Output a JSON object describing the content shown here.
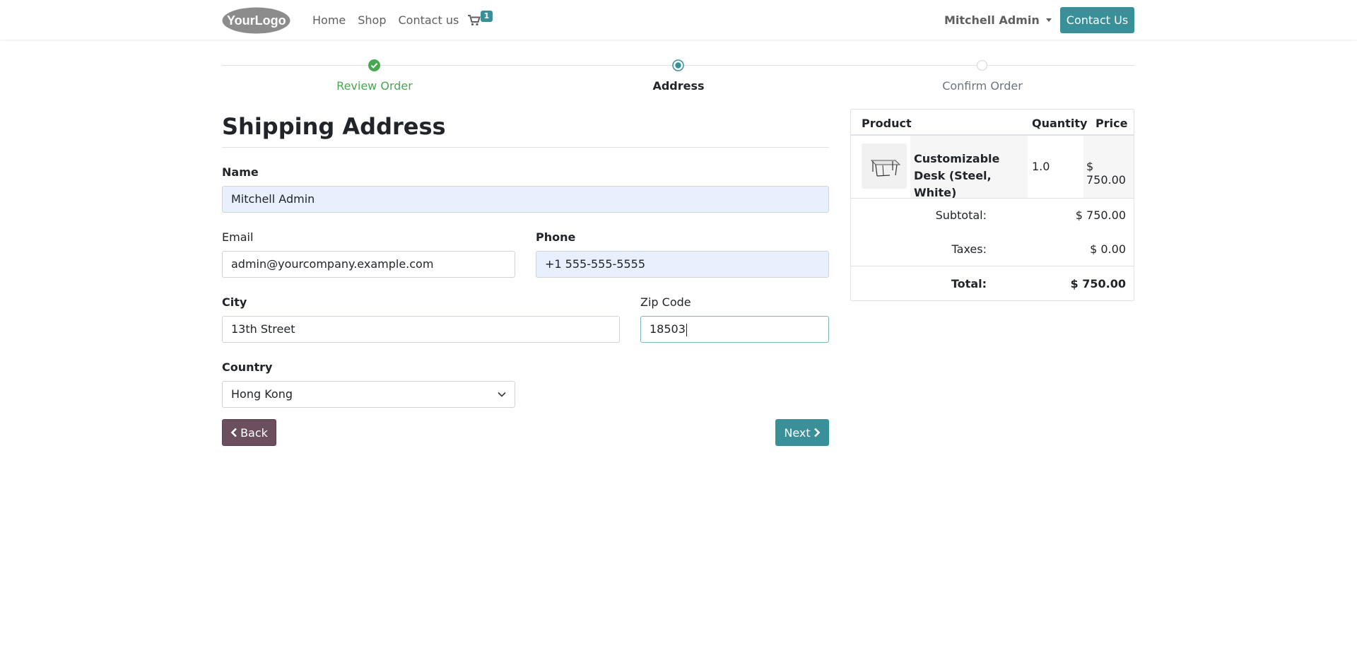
{
  "header": {
    "logo_text": "YourLogo",
    "nav": [
      {
        "label": "Home"
      },
      {
        "label": "Shop"
      },
      {
        "label": "Contact us"
      }
    ],
    "cart_count": "1",
    "user_name": "Mitchell Admin",
    "contact_button": "Contact Us"
  },
  "progress": {
    "steps": [
      {
        "label": "Review Order",
        "state": "done"
      },
      {
        "label": "Address",
        "state": "active"
      },
      {
        "label": "Confirm Order",
        "state": "pending"
      }
    ]
  },
  "form": {
    "title": "Shipping Address",
    "name_label": "Name",
    "name_value": "Mitchell Admin",
    "email_label": "Email",
    "email_value": "admin@yourcompany.example.com",
    "phone_label": "Phone",
    "phone_value": "+1 555-555-5555",
    "city_label": "City",
    "city_value": "13th Street",
    "zip_label": "Zip Code",
    "zip_value": "18503",
    "country_label": "Country",
    "country_value": "Hong Kong",
    "back_button": "Back",
    "next_button": "Next"
  },
  "summary": {
    "col_product": "Product",
    "col_quantity": "Quantity",
    "col_price": "Price",
    "product_name": "Customizable Desk (Steel, White)",
    "product_qty": "1.0",
    "product_price": "$ 750.00",
    "subtotal_label": "Subtotal:",
    "subtotal_value": "$ 750.00",
    "taxes_label": "Taxes:",
    "taxes_value": "$ 0.00",
    "total_label": "Total:",
    "total_value": "$ 750.00"
  },
  "colors": {
    "primary": "#3a9099",
    "secondary": "#6c4f5e",
    "success": "#47a84f",
    "autofill": "#e8f0fe",
    "corner": "#6c4f75"
  }
}
